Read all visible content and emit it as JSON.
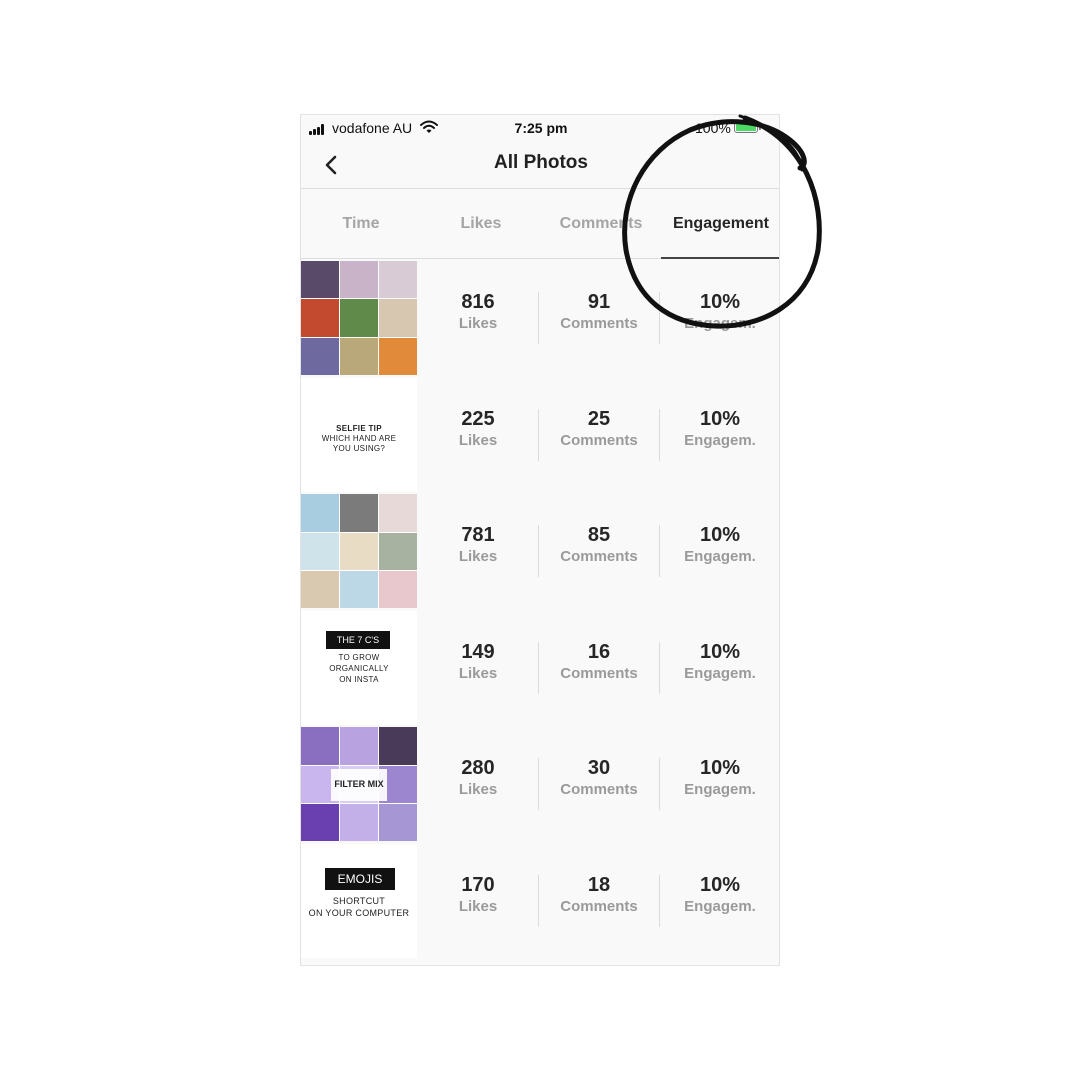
{
  "status_bar": {
    "carrier": "vodafone AU",
    "time": "7:25 pm",
    "battery_percent": "100%",
    "battery_level": 1.0
  },
  "nav": {
    "title": "All Photos"
  },
  "tabs": [
    {
      "label": "Time",
      "active": false
    },
    {
      "label": "Likes",
      "active": false
    },
    {
      "label": "Comments",
      "active": false
    },
    {
      "label": "Engagement",
      "active": true
    }
  ],
  "rows": [
    {
      "likes": "816",
      "likes_label": "Likes",
      "comments": "91",
      "comments_label": "Comments",
      "engagement": "10%",
      "engagement_label": "Engagem."
    },
    {
      "likes": "225",
      "likes_label": "Likes",
      "comments": "25",
      "comments_label": "Comments",
      "engagement": "10%",
      "engagement_label": "Engagem.",
      "thumb_text": {
        "title": "SELFIE TIP",
        "line1": "WHICH HAND ARE",
        "line2": "YOU USING?"
      }
    },
    {
      "likes": "781",
      "likes_label": "Likes",
      "comments": "85",
      "comments_label": "Comments",
      "engagement": "10%",
      "engagement_label": "Engagem."
    },
    {
      "likes": "149",
      "likes_label": "Likes",
      "comments": "16",
      "comments_label": "Comments",
      "engagement": "10%",
      "engagement_label": "Engagem.",
      "thumb_text": {
        "title": "THE 7 C'S",
        "line1": "TO GROW",
        "line2": "ORGANICALLY",
        "line3": "ON INSTA"
      }
    },
    {
      "likes": "280",
      "likes_label": "Likes",
      "comments": "30",
      "comments_label": "Comments",
      "engagement": "10%",
      "engagement_label": "Engagem.",
      "thumb_text": {
        "title": "FILTER MIX"
      }
    },
    {
      "likes": "170",
      "likes_label": "Likes",
      "comments": "18",
      "comments_label": "Comments",
      "engagement": "10%",
      "engagement_label": "Engagem.",
      "thumb_text": {
        "title": "EMOJIS",
        "line1": "SHORTCUT",
        "line2": "ON YOUR COMPUTER"
      }
    }
  ],
  "colors": {
    "active_tab": "#262626",
    "inactive_tab": "#a5a5a5",
    "stat_label": "#9a9a9a",
    "battery": "#4cd964",
    "annotation": "#111111"
  },
  "icons": [
    "signal-icon",
    "wifi-icon",
    "battery-icon",
    "back-chevron-icon"
  ]
}
